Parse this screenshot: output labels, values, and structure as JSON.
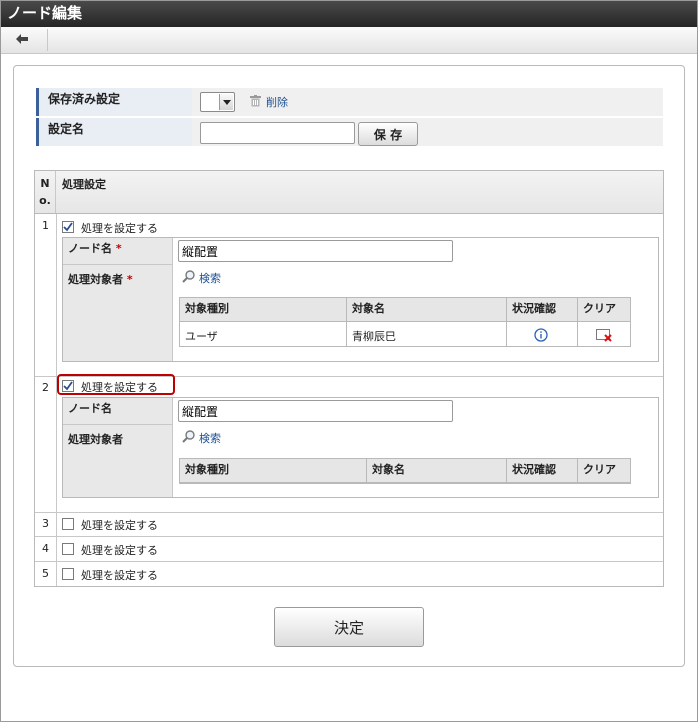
{
  "app": {
    "title": "ノード編集"
  },
  "saved": {
    "label": "保存済み設定",
    "delete_label": "削除"
  },
  "setting_name": {
    "label": "設定名",
    "value": "",
    "save_label": "保 存"
  },
  "table": {
    "header_no": "N o.",
    "header_title": "処理設定",
    "rows": [
      {
        "no": "1",
        "checkbox_label": "処理を設定する",
        "checked": true,
        "node_name_label": "ノード名",
        "node_name_value": "縦配置",
        "target_label": "処理対象者",
        "search_label": "検索",
        "sub_headers": [
          "対象種別",
          "対象名",
          "状況確認",
          "クリア"
        ],
        "sub_rows": [
          {
            "type": "ユーザ",
            "name": "青柳辰巳"
          }
        ]
      },
      {
        "no": "2",
        "checkbox_label": "処理を設定する",
        "checked": true,
        "node_name_label": "ノード名",
        "node_name_value": "縦配置",
        "target_label": "処理対象者",
        "search_label": "検索",
        "sub_headers": [
          "対象種別",
          "対象名",
          "状況確認",
          "クリア"
        ]
      },
      {
        "no": "3",
        "checkbox_label": "処理を設定する",
        "checked": false
      },
      {
        "no": "4",
        "checkbox_label": "処理を設定する",
        "checked": false
      },
      {
        "no": "5",
        "checkbox_label": "処理を設定する",
        "checked": false
      }
    ]
  },
  "decide_label": "決定",
  "colors": {
    "highlight": "#c00000",
    "accent": "#3a5f9b",
    "link": "#1d4f91"
  }
}
